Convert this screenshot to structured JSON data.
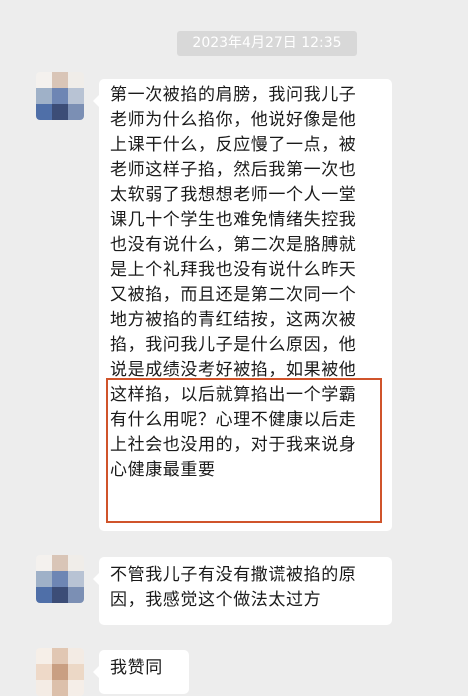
{
  "timestamp": "2023年4月27日 12:35",
  "messages": [
    {
      "lines": [
        "第一次被掐的肩膀，我问我儿子",
        "老师为什么掐你，他说好像是他",
        "上课干什么，反应慢了一点，被",
        "老师这样子掐，然后我第一次也",
        "太软弱了我想想老师一个人一堂",
        "课几十个学生也难免情绪失控我",
        "也没有说什么，第二次是胳膊就",
        "是上个礼拜我也没有说什么昨天",
        "又被掐，而且还是第二次同一个",
        "地方被掐的青红结按，这两次被",
        "掐，我问我儿子是什么原因，他",
        "说是成绩没考好被掐，如果被他",
        "这样掐，以后就算掐出一个学霸",
        "有什么用呢？心理不健康以后走",
        "上社会也没用的，对于我来说身",
        "心健康最重要"
      ]
    },
    {
      "lines": [
        "不管我儿子有没有撒谎被掐的原",
        "因，我感觉这个做法太过方"
      ]
    },
    {
      "lines": [
        "我赞同"
      ]
    }
  ],
  "colors": {
    "background": "#ededed",
    "bubble": "#ffffff",
    "highlight_border": "#d0542b",
    "timestamp_bg": "#d8d8d8"
  },
  "icons": [
    "avatar-blurred"
  ]
}
